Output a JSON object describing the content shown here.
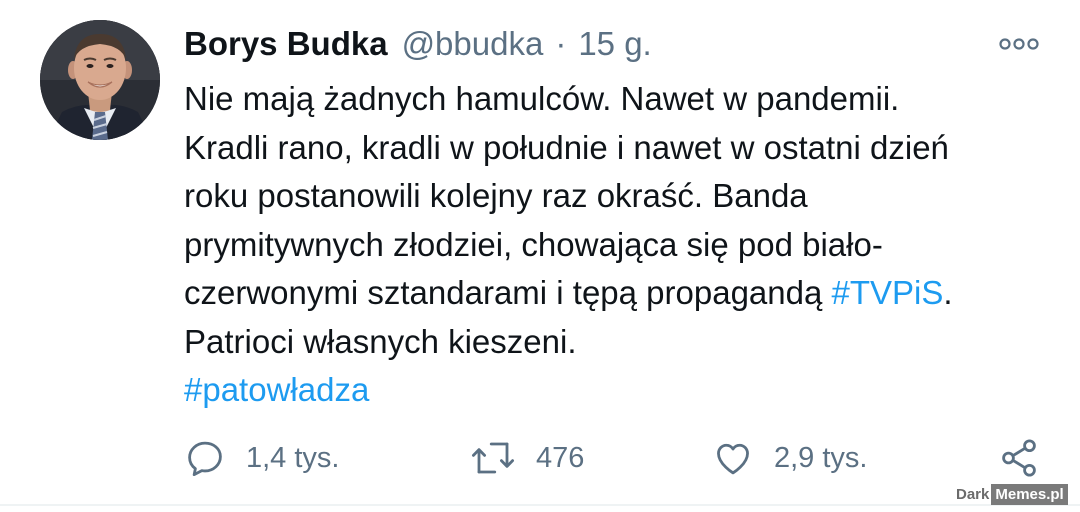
{
  "author": {
    "display_name": "Borys Budka",
    "handle": "@bbudka",
    "separator": "·",
    "time": "15 g."
  },
  "tweet": {
    "lines": [
      "Nie mają żadnych hamulców. Nawet w pandemii.",
      "Kradli rano, kradli w południe i nawet w ostatni dzień",
      "roku postanowili kolejny raz okraść. Banda",
      "prymitywnych złodziei, chowająca się pod biało-",
      "czerwonymi sztandarami i tępą propagandą "
    ],
    "hashtag_inline": "#TVPiS",
    "line5_suffix": ".",
    "line6": "Patrioci własnych kieszeni.",
    "hashtag_final": "#patowładza"
  },
  "actions": {
    "reply_count": "1,4 tys.",
    "retweet_count": "476",
    "like_count": "2,9 tys.",
    "reply_icon": "reply-icon",
    "retweet_icon": "retweet-icon",
    "like_icon": "heart-icon",
    "share_icon": "share-icon"
  },
  "watermark": {
    "part1": "Dark",
    "part2": "Memes.pl"
  },
  "colors": {
    "text": "#0f1419",
    "secondary": "#5b7083",
    "link": "#1d9bf0"
  }
}
